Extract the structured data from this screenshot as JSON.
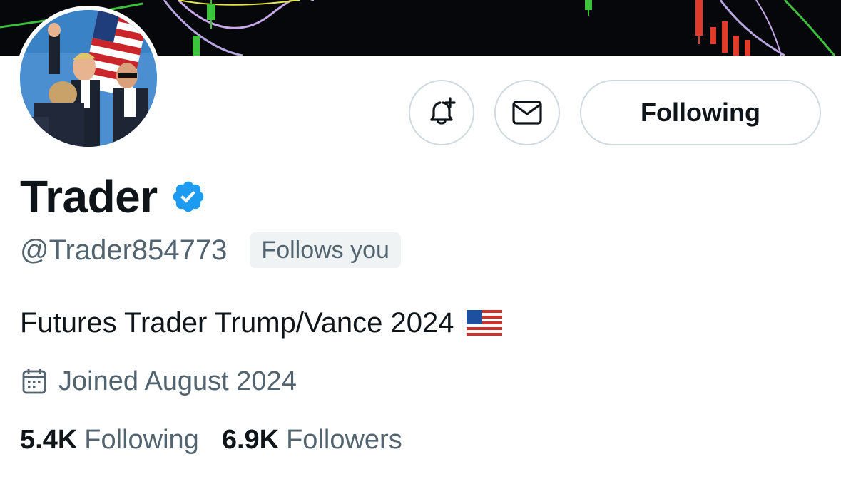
{
  "profile": {
    "display_name": "Trader",
    "handle": "@Trader854773",
    "follows_you": "Follows you",
    "bio": "Futures Trader Trump/Vance 2024",
    "bio_emoji": "us-flag-emoji",
    "joined": "Joined August 2024"
  },
  "actions": {
    "notify_icon": "bell-plus-icon",
    "message_icon": "envelope-icon",
    "follow_label": "Following"
  },
  "stats": {
    "following_count": "5.4K",
    "following_label": "Following",
    "followers_count": "6.9K",
    "followers_label": "Followers"
  },
  "colors": {
    "verified": "#1d9bf0",
    "secondary_text": "#536471",
    "border": "#cfd9de",
    "badge_bg": "#eff3f4",
    "banner_bg": "#05070a"
  }
}
